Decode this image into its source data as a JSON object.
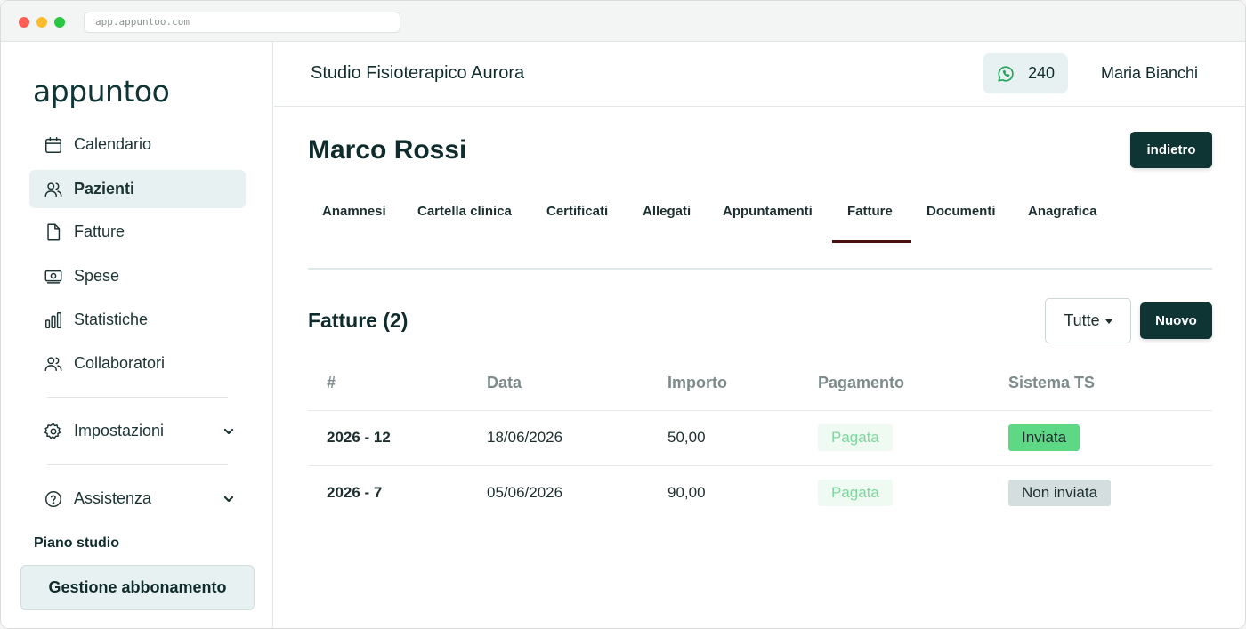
{
  "browser": {
    "url": "app.appuntoo.com"
  },
  "sidebar": {
    "logo": "appuntoo",
    "items": [
      {
        "label": "Calendario",
        "icon": "calendar-icon"
      },
      {
        "label": "Pazienti",
        "icon": "users-icon",
        "active": true
      },
      {
        "label": "Fatture",
        "icon": "document-icon"
      },
      {
        "label": "Spese",
        "icon": "money-icon"
      },
      {
        "label": "Statistiche",
        "icon": "bar-chart-icon"
      },
      {
        "label": "Collaboratori",
        "icon": "users-icon"
      }
    ],
    "settings": {
      "label": "Impostazioni",
      "icon": "gear-icon"
    },
    "help": {
      "label": "Assistenza",
      "icon": "help-icon"
    },
    "plan_label": "Piano studio",
    "plan_button": "Gestione abbonamento"
  },
  "header": {
    "studio_name": "Studio Fisioterapico Aurora",
    "whatsapp_count": "240",
    "user_name": "Maria Bianchi"
  },
  "patient": {
    "name": "Marco Rossi",
    "back_label": "indietro"
  },
  "tabs": [
    {
      "label": "Anamnesi"
    },
    {
      "label": "Cartella clinica"
    },
    {
      "label": "Certificati"
    },
    {
      "label": "Allegati"
    },
    {
      "label": "Appuntamenti"
    },
    {
      "label": "Fatture",
      "active": true
    },
    {
      "label": "Documenti"
    },
    {
      "label": "Anagrafica"
    }
  ],
  "invoices": {
    "title": "Fatture (2)",
    "filter_value": "Tutte",
    "new_label": "Nuovo",
    "columns": [
      "#",
      "Data",
      "Importo",
      "Pagamento",
      "Sistema TS"
    ],
    "rows": [
      {
        "number": "2026 - 12",
        "date": "18/06/2026",
        "amount": "50,00",
        "payment": "Pagata",
        "ts": "Inviata"
      },
      {
        "number": "2026 - 7",
        "date": "05/06/2026",
        "amount": "90,00",
        "payment": "Pagata",
        "ts": "Non inviata"
      }
    ]
  },
  "colors": {
    "primary_dark": "#0e3434",
    "active_tab_underline": "#4a1010",
    "sidebar_active_bg": "#e8f1f1",
    "paid_badge_bg": "#eefaf2",
    "paid_badge_text": "#7dd79c",
    "ts_sent_bg": "#5ed884",
    "ts_not_sent_bg": "#d4dede",
    "whatsapp_green": "#25a35a"
  }
}
